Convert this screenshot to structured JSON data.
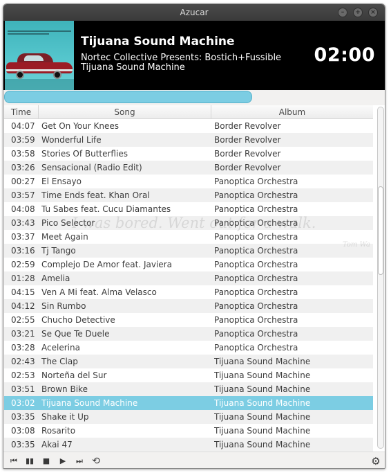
{
  "window": {
    "title": "Azucar"
  },
  "now_playing": {
    "title": "Tijuana Sound Machine",
    "album": "Nortec Collective Presents: Bostich+Fussible",
    "artist": "Tijuana Sound Machine",
    "time": "02:00",
    "progress_fraction": 0.65
  },
  "columns": {
    "time": "Time",
    "song": "Song",
    "album": "Album"
  },
  "tracks": [
    {
      "time": "04:07",
      "song": "Get On Your Knees",
      "album": "Border Revolver"
    },
    {
      "time": "03:59",
      "song": "Wonderful Life",
      "album": "Border Revolver"
    },
    {
      "time": "03:58",
      "song": "Stories Of Butterflies",
      "album": "Border Revolver"
    },
    {
      "time": "03:26",
      "song": "Sensacional (Radio Edit)",
      "album": "Border Revolver"
    },
    {
      "time": "00:27",
      "song": "El Ensayo",
      "album": "Panoptica Orchestra"
    },
    {
      "time": "03:57",
      "song": "Time Ends feat. Khan Oral",
      "album": "Panoptica Orchestra"
    },
    {
      "time": "04:08",
      "song": "Tu Sabes feat. Cucu Diamantes",
      "album": "Panoptica Orchestra"
    },
    {
      "time": "03:43",
      "song": "Pico Selector",
      "album": "Panoptica Orchestra"
    },
    {
      "time": "03:37",
      "song": "Meet Again",
      "album": "Panoptica Orchestra"
    },
    {
      "time": "03:16",
      "song": "Tj Tango",
      "album": "Panoptica Orchestra"
    },
    {
      "time": "02:59",
      "song": "Complejo De Amor feat. Javiera",
      "album": "Panoptica Orchestra"
    },
    {
      "time": "01:28",
      "song": "Amelia",
      "album": "Panoptica Orchestra"
    },
    {
      "time": "04:15",
      "song": "Ven A Mi feat. Alma Velasco",
      "album": "Panoptica Orchestra"
    },
    {
      "time": "04:12",
      "song": "Sin Rumbo",
      "album": "Panoptica Orchestra"
    },
    {
      "time": "02:55",
      "song": "Chucho Detective",
      "album": "Panoptica Orchestra"
    },
    {
      "time": "03:21",
      "song": "Se Que Te Duele",
      "album": "Panoptica Orchestra"
    },
    {
      "time": "03:28",
      "song": "Acelerina",
      "album": "Panoptica Orchestra"
    },
    {
      "time": "02:43",
      "song": "The Clap",
      "album": "Tijuana Sound Machine"
    },
    {
      "time": "02:53",
      "song": "Norteña del Sur",
      "album": "Tijuana Sound Machine"
    },
    {
      "time": "03:51",
      "song": "Brown Bike",
      "album": "Tijuana Sound Machine"
    },
    {
      "time": "03:02",
      "song": "Tijuana Sound Machine",
      "album": "Tijuana Sound Machine",
      "selected": true
    },
    {
      "time": "03:35",
      "song": "Shake it Up",
      "album": "Tijuana Sound Machine"
    },
    {
      "time": "03:08",
      "song": "Rosarito",
      "album": "Tijuana Sound Machine"
    },
    {
      "time": "03:35",
      "song": "Akai 47",
      "album": "Tijuana Sound Machine"
    }
  ],
  "watermark": {
    "main": "I was bored. Went out for a walk.",
    "sub": "Tom Wa"
  },
  "controls": {
    "prev_icon": "skip-back-icon",
    "pause_icon": "pause-icon",
    "stop_icon": "stop-icon",
    "play_icon": "play-icon",
    "next_icon": "skip-forward-icon",
    "repeat_icon": "repeat-icon",
    "settings_icon": "gear-icon"
  },
  "colors": {
    "accent": "#7ccde3",
    "header_bg": "#000000",
    "titlebar_bg": "#3f3f3f"
  }
}
